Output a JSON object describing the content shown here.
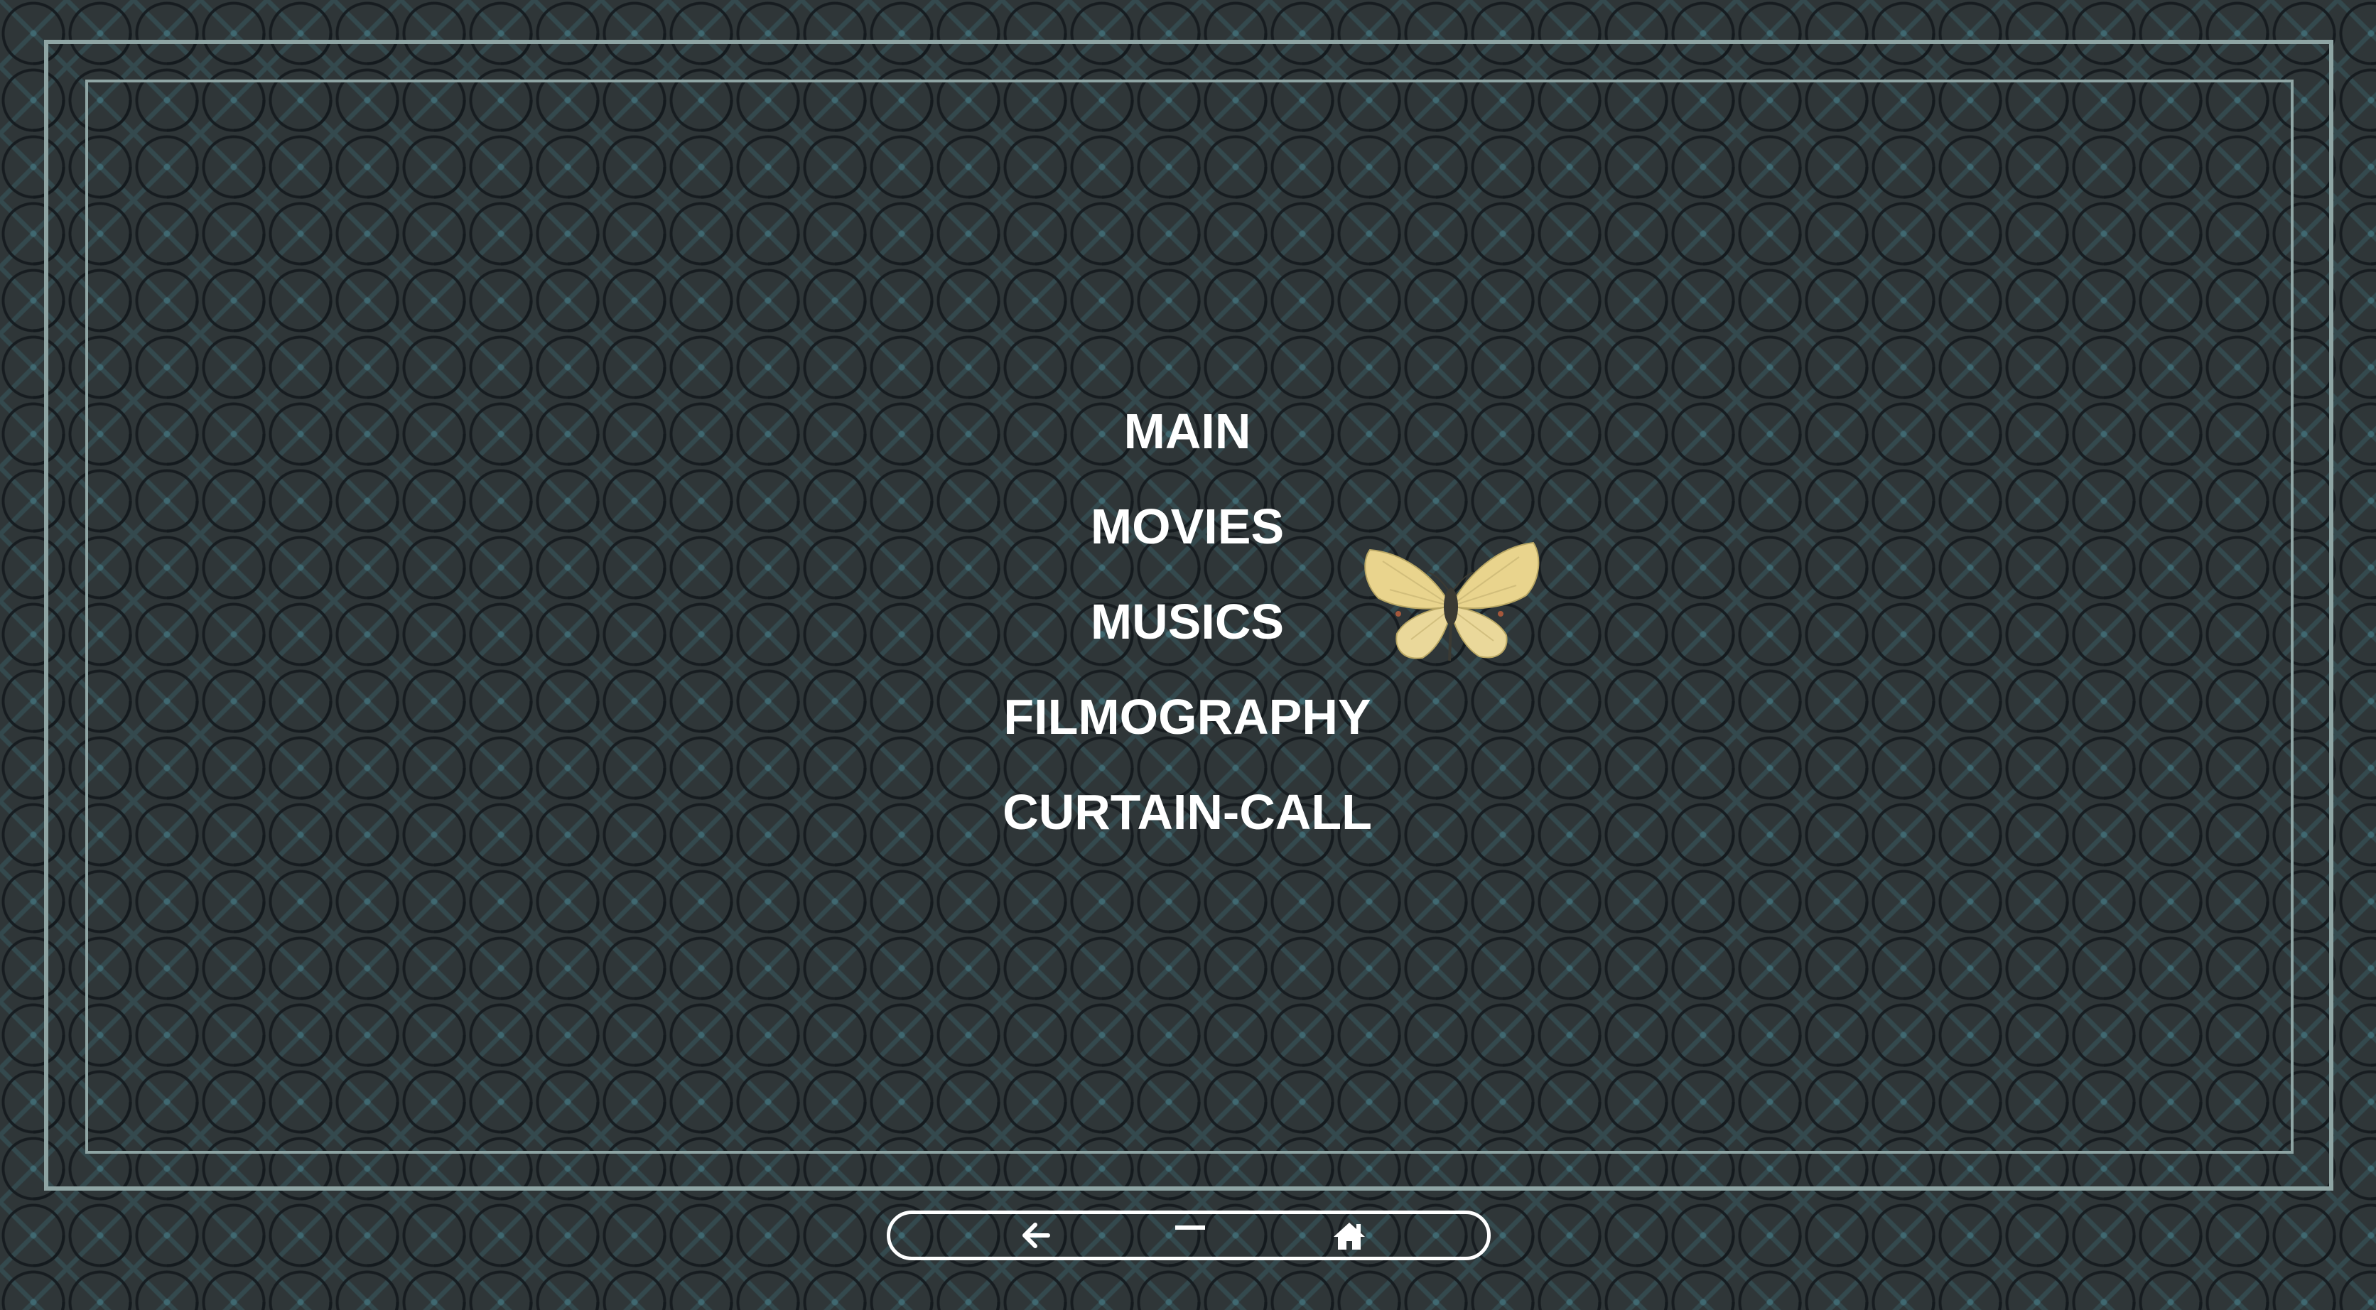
{
  "menu": {
    "items": [
      {
        "label": "MAIN"
      },
      {
        "label": "MOVIES"
      },
      {
        "label": "MUSICS"
      },
      {
        "label": "FILMOGRAPHY"
      },
      {
        "label": "CURTAIN-CALL"
      }
    ]
  },
  "decoration": {
    "butterfly": "butterfly-image"
  },
  "bottom_bar": {
    "back_icon": "back-arrow-icon",
    "minimize_icon": "minimize-icon",
    "home_icon": "home-icon"
  },
  "colors": {
    "background": "#2f3638",
    "frame": "#8fa5a4",
    "text": "#ffffff",
    "butterfly_wing": "#e9d48d"
  }
}
